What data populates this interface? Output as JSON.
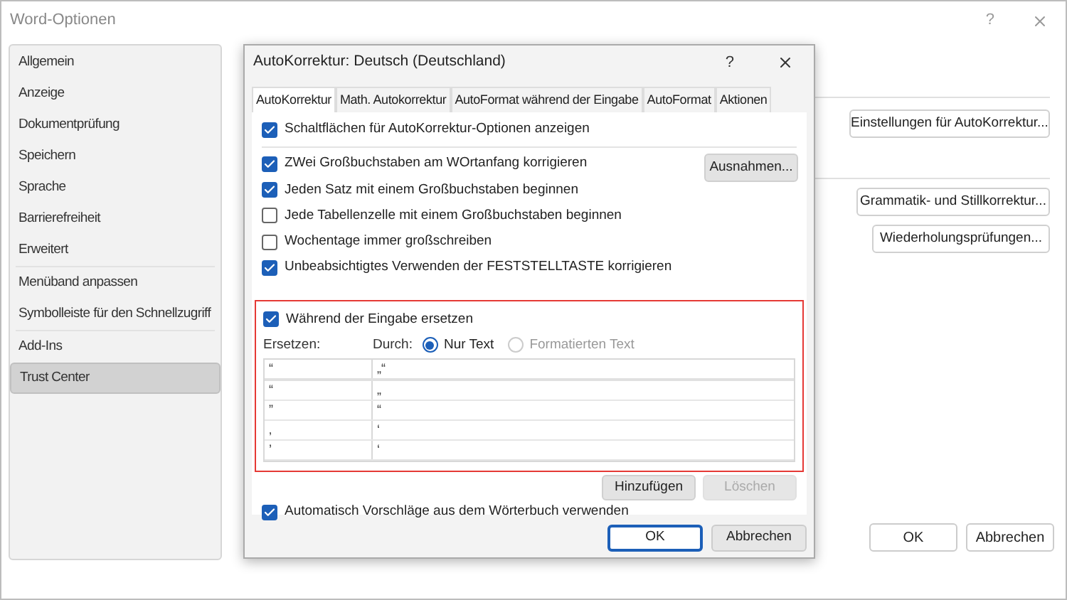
{
  "window": {
    "title": "Word-Optionen",
    "help": "?"
  },
  "sidebar": {
    "groups": [
      {
        "items": [
          {
            "label": "Allgemein",
            "selected": false
          },
          {
            "label": "Anzeige",
            "selected": false
          },
          {
            "label": "Dokumentprüfung",
            "selected": false
          },
          {
            "label": "Speichern",
            "selected": false
          },
          {
            "label": "Sprache",
            "selected": false
          },
          {
            "label": "Barrierefreiheit",
            "selected": false
          },
          {
            "label": "Erweitert",
            "selected": false
          }
        ]
      },
      {
        "items": [
          {
            "label": "Menüband anpassen",
            "selected": false
          },
          {
            "label": "Symbolleiste für den Schnellzugriff",
            "selected": false
          }
        ]
      },
      {
        "items": [
          {
            "label": "Add-Ins",
            "selected": false
          },
          {
            "label": "Trust Center",
            "selected": true
          }
        ]
      }
    ]
  },
  "content": {
    "buttons": [
      "Einstellungen für AutoKorrektur...",
      "Grammatik- und Stillkorrektur...",
      "Wiederholungsprüfungen..."
    ]
  },
  "footer": {
    "buttons": [
      "OK",
      "Abbrechen"
    ]
  },
  "dialog": {
    "title": "AutoKorrektur: Deutsch (Deutschland)",
    "help": "?",
    "tabs": [
      {
        "label": "AutoKorrektur",
        "selected": true
      },
      {
        "label": "Math. Autokorrektur",
        "selected": false
      },
      {
        "label": "AutoFormat während der Eingabe",
        "selected": false
      },
      {
        "label": "AutoFormat",
        "selected": false
      },
      {
        "label": "Aktionen",
        "selected": false
      }
    ],
    "top_option": {
      "label": "Schaltflächen für AutoKorrektur-Optionen anzeigen",
      "checked": true
    },
    "options": [
      {
        "label": "ZWei Großbuchstaben am WOrtanfang korrigieren",
        "checked": true
      },
      {
        "label": "Jeden Satz mit einem Großbuchstaben beginnen",
        "checked": true
      },
      {
        "label": "Jede Tabellenzelle mit einem Großbuchstaben beginnen",
        "checked": false
      },
      {
        "label": "Wochentage immer großschreiben",
        "checked": false
      },
      {
        "label": "Unbeabsichtigtes Verwenden der FESTSTELLTASTE korrigieren",
        "checked": true
      }
    ],
    "exceptions_button": "Ausnahmen...",
    "replace": {
      "option": {
        "label": "Während der Eingabe ersetzen",
        "checked": true
      },
      "replace_label": "Ersetzen:",
      "with_label": "Durch:",
      "radios": [
        {
          "label": "Nur Text",
          "selected": true,
          "disabled": false
        },
        {
          "label": "Formatierten Text",
          "selected": false,
          "disabled": true
        }
      ],
      "entry": {
        "replace": "“",
        "with": "„“"
      },
      "rows": [
        {
          "replace": "“",
          "with": "„"
        },
        {
          "replace": "”",
          "with": "“"
        },
        {
          "replace": "‚",
          "with": "‘"
        },
        {
          "replace": "’",
          "with": "‘"
        }
      ]
    },
    "buttons": [
      {
        "label": "Hinzufügen",
        "disabled": false
      },
      {
        "label": "Löschen",
        "disabled": true
      }
    ],
    "bottom_option": {
      "label": "Automatisch Vorschläge aus dem Wörterbuch verwenden",
      "checked": true
    },
    "footer": [
      {
        "label": "OK",
        "default": true
      },
      {
        "label": "Abbrechen",
        "default": false
      }
    ]
  }
}
